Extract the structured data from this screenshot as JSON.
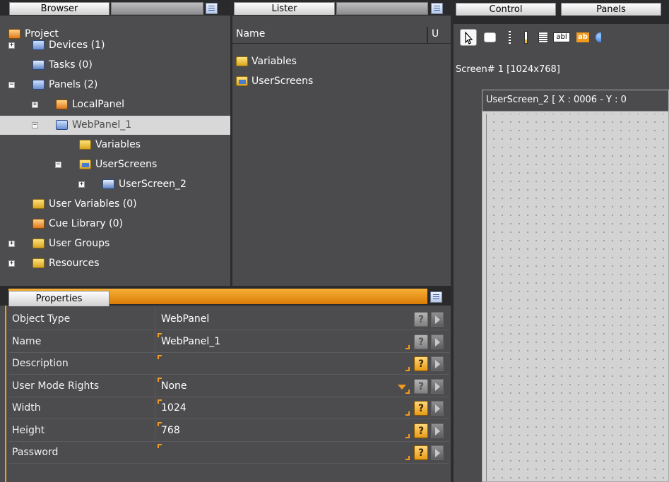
{
  "browser": {
    "tab_label": "Browser",
    "tree": [
      {
        "label": "Project",
        "expander": "",
        "icon": "project-icon"
      },
      {
        "label": "Devices (1)",
        "expander": "+",
        "icon": "devices-icon"
      },
      {
        "label": "Tasks (0)",
        "expander": "",
        "icon": "tasks-icon"
      },
      {
        "label": "Panels (2)",
        "expander": "–",
        "icon": "panels-icon"
      },
      {
        "label": "LocalPanel",
        "expander": "+",
        "icon": "local-panel-icon"
      },
      {
        "label": "WebPanel_1",
        "expander": "–",
        "icon": "web-panel-icon"
      },
      {
        "label": "Variables",
        "expander": "",
        "icon": "variables-folder-icon"
      },
      {
        "label": "UserScreens",
        "expander": "–",
        "icon": "userscreens-folder-icon"
      },
      {
        "label": "UserScreen_2",
        "expander": "+",
        "icon": "userscreen-icon"
      },
      {
        "label": "User Variables (0)",
        "expander": "",
        "icon": "user-variables-folder-icon"
      },
      {
        "label": "Cue Library (0)",
        "expander": "",
        "icon": "cue-library-icon"
      },
      {
        "label": "User Groups",
        "expander": "+",
        "icon": "user-groups-folder-icon"
      },
      {
        "label": "Resources",
        "expander": "+",
        "icon": "resources-folder-icon"
      }
    ]
  },
  "lister": {
    "tab_label": "Lister",
    "column_name": "Name",
    "column_u": "U",
    "items": [
      "Variables",
      "UserScreens"
    ]
  },
  "properties": {
    "tab_label": "Properties",
    "rows": [
      {
        "name": "Object Type",
        "value": "WebPanel",
        "help_active": false
      },
      {
        "name": "Name",
        "value": "WebPanel_1",
        "help_active": false
      },
      {
        "name": "Description",
        "value": "",
        "help_active": true
      },
      {
        "name": "User Mode Rights",
        "value": "None",
        "help_active": false
      },
      {
        "name": "Width",
        "value": "1024",
        "help_active": true
      },
      {
        "name": "Height",
        "value": "768",
        "help_active": true
      },
      {
        "name": "Password",
        "value": "",
        "help_active": true
      }
    ]
  },
  "right": {
    "tabs": [
      "Control",
      "Panels"
    ],
    "screen_label": "Screen# 1 [1024x768]",
    "window_title": "UserScreen_2 [ X : 0006 - Y : 0"
  },
  "toolbar": {
    "text_btn": "abl",
    "text_btn2": "ab"
  },
  "colors": {
    "accent": "#f29b1e",
    "panel_bg": "#4d4d50",
    "canvas_bg": "#d3d3d3"
  }
}
